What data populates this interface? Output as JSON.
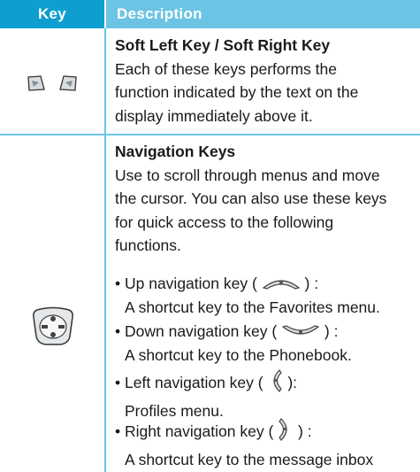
{
  "header": {
    "key": "Key",
    "description": "Description"
  },
  "rows": [
    {
      "title": "Soft Left Key / Soft Right Key",
      "lines": [
        "Each of these keys performs the",
        "function indicated by the text on the",
        "display immediately above it."
      ],
      "icons": [
        "soft-left-key-icon",
        "soft-right-key-icon"
      ]
    },
    {
      "title": "Navigation Keys",
      "lines": [
        "Use to scroll through menus and move",
        "the cursor. You can also use these keys",
        "for quick access to the following",
        "functions."
      ],
      "icons": [
        "navigation-key-icon"
      ],
      "bullets": [
        {
          "prefix": "• Up navigation key (",
          "suffix": ") :",
          "detail": "A shortcut key to the Favorites menu.",
          "icon": "up-navigation-key-icon"
        },
        {
          "prefix": "• Down navigation key (",
          "suffix": ") :",
          "detail": "A shortcut key to the Phonebook.",
          "icon": "down-navigation-key-icon"
        },
        {
          "prefix": "• Left navigation key (",
          "suffix": "):",
          "detail": "Profiles menu.",
          "icon": "left-navigation-key-icon"
        },
        {
          "prefix": "• Right navigation key (",
          "suffix": ") :",
          "detail": "A shortcut key to the message inbox",
          "icon": "right-navigation-key-icon"
        }
      ]
    }
  ]
}
